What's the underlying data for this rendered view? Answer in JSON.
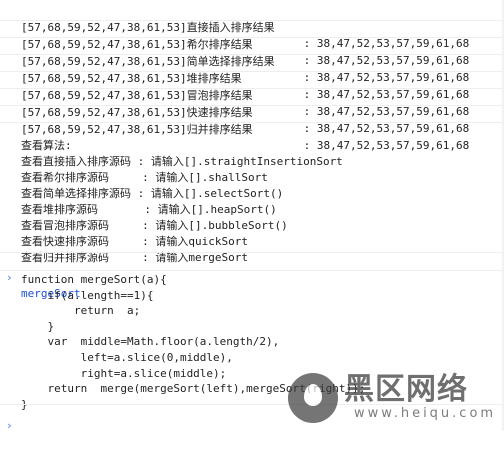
{
  "results": [
    {
      "input": "[57,68,59,52,47,38,61,53]",
      "method": "直接插入排序结果",
      "sep": " : ",
      "output": "38,47,52,53,57,59,61,68"
    },
    {
      "input": "[57,68,59,52,47,38,61,53]",
      "method": "希尔排序结果",
      "sep": " : ",
      "output": "38,47,52,53,57,59,61,68"
    },
    {
      "input": "[57,68,59,52,47,38,61,53]",
      "method": "简单选择排序结果",
      "sep": " : ",
      "output": "38,47,52,53,57,59,61,68"
    },
    {
      "input": "[57,68,59,52,47,38,61,53]",
      "method": "堆排序结果",
      "sep": " : ",
      "output": "38,47,52,53,57,59,61,68"
    },
    {
      "input": "[57,68,59,52,47,38,61,53]",
      "method": "冒泡排序结果",
      "sep": " : ",
      "output": "38,47,52,53,57,59,61,68"
    },
    {
      "input": "[57,68,59,52,47,38,61,53]",
      "method": "快速排序结果",
      "sep": " : ",
      "output": "38,47,52,53,57,59,61,68"
    },
    {
      "input": "[57,68,59,52,47,38,61,53]",
      "method": "归并排序结果",
      "sep": " : ",
      "output": "38,47,52,53,57,59,61,68"
    }
  ],
  "algo_header": "查看算法:",
  "algos": [
    {
      "label": "查看直接插入排序源码",
      "hint": " : 请输入[].straightInsertionSort"
    },
    {
      "label": "查看希尔排序源码    ",
      "hint": " : 请输入[].shallSort"
    },
    {
      "label": "查看简单选择排序源码",
      "hint": " : 请输入[].selectSort()"
    },
    {
      "label": "查看堆排序源码      ",
      "hint": " : 请输入[].heapSort()"
    },
    {
      "label": "查看冒泡排序源码    ",
      "hint": " : 请输入[].bubbleSort()"
    },
    {
      "label": "查看快速排序源码    ",
      "hint": " : 请输入quickSort"
    },
    {
      "label": "查看归并排序源码    ",
      "hint": " : 请输入mergeSort"
    }
  ],
  "command": {
    "prompt": "›",
    "text": "mergeSort"
  },
  "output_code": "function mergeSort(a){\n    if(a.length==1){\n        return  a;\n    }\n    var  middle=Math.floor(a.length/2),\n         left=a.slice(0,middle),\n         right=a.slice(middle);\n    return  merge(mergeSort(left),mergeSort(right));\n}",
  "input_prompt": "›",
  "watermark": {
    "title": "黑区网络",
    "url": "www.heiqu.com"
  },
  "colors": {
    "prompt": "#367cf1",
    "command": "#1a4fd6",
    "text": "#222222"
  }
}
